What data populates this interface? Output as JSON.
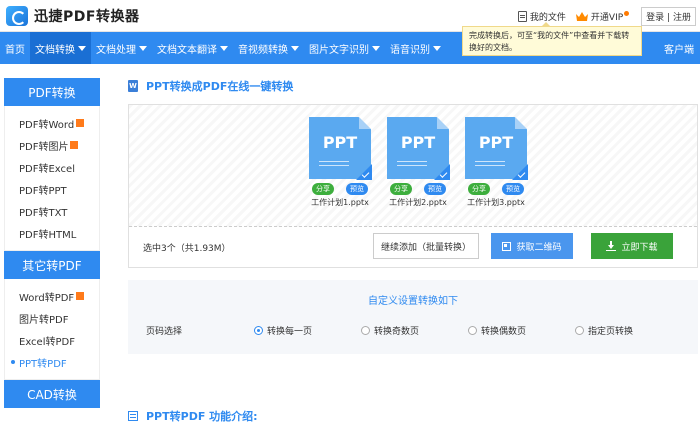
{
  "app": {
    "title": "迅捷PDF转换器"
  },
  "top": {
    "my_files": "我的文件",
    "vip": "开通VIP",
    "login": "登录",
    "divider": "|",
    "register": "注册"
  },
  "tooltip": "完成转换后，可至“我的文件”中查看并下载转换好的文档。",
  "nav": {
    "items": [
      {
        "label": "首页",
        "dropdown": false
      },
      {
        "label": "文档转换",
        "dropdown": true
      },
      {
        "label": "文档处理",
        "dropdown": true
      },
      {
        "label": "文档文本翻译",
        "dropdown": true
      },
      {
        "label": "音视频转换",
        "dropdown": true
      },
      {
        "label": "图片文字识别",
        "dropdown": true
      },
      {
        "label": "语音识别",
        "dropdown": true
      }
    ],
    "right": "客户端"
  },
  "sidebar": {
    "pdf_header": "PDF转换",
    "pdf_items": [
      {
        "label": "PDF转Word",
        "hot": true
      },
      {
        "label": "PDF转图片",
        "hot": true
      },
      {
        "label": "PDF转Excel",
        "hot": false
      },
      {
        "label": "PDF转PPT",
        "hot": false
      },
      {
        "label": "PDF转TXT",
        "hot": false
      },
      {
        "label": "PDF转HTML",
        "hot": false
      }
    ],
    "other_header": "其它转PDF",
    "other_items": [
      {
        "label": "Word转PDF",
        "hot": true
      },
      {
        "label": "图片转PDF",
        "hot": false
      },
      {
        "label": "Excel转PDF",
        "hot": false
      },
      {
        "label": "PPT转PDF",
        "hot": false
      }
    ],
    "cad_header": "CAD转换"
  },
  "main": {
    "title": "PPT转换成PDF在线一键转换",
    "files": [
      {
        "type": "PPT",
        "name": "工作计划1.pptx",
        "share": "分享",
        "preview": "预览"
      },
      {
        "type": "PPT",
        "name": "工作计划2.pptx",
        "share": "分享",
        "preview": "预览"
      },
      {
        "type": "PPT",
        "name": "工作计划3.pptx",
        "share": "分享",
        "preview": "预览"
      }
    ],
    "selection": "选中3个（共1.93M）",
    "add_more": "继续添加（批量转换）",
    "qr": "获取二维码",
    "download": "立即下载",
    "settings": {
      "title": "自定义设置转换如下",
      "row_label": "页码选择",
      "options": [
        "转换每一页",
        "转换奇数页",
        "转换偶数页",
        "指定页转换"
      ],
      "selected_index": 0
    },
    "intro": "PPT转PDF 功能介绍:"
  },
  "colors": {
    "primary": "#2f8af0",
    "green": "#3aa33a"
  }
}
